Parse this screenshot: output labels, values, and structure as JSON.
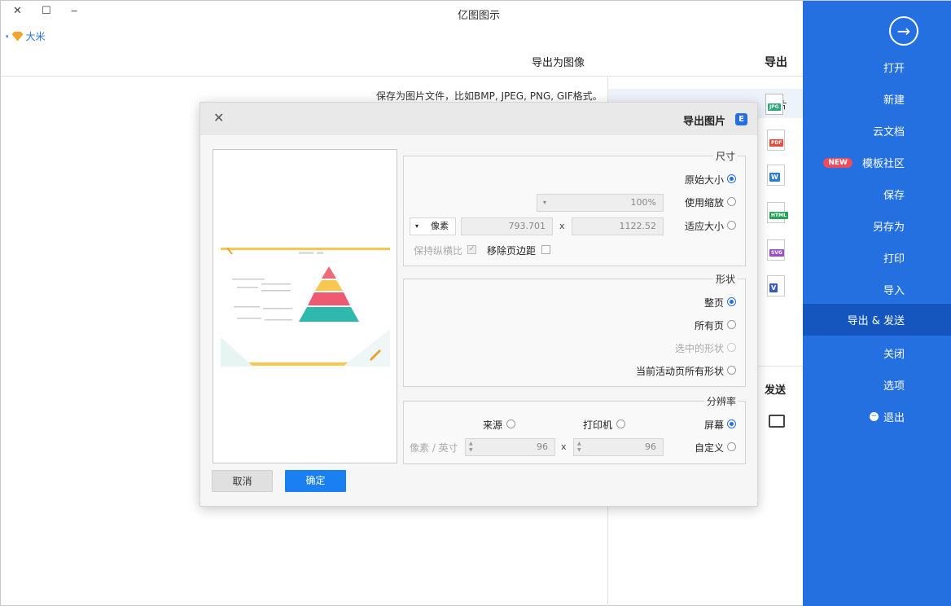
{
  "app": {
    "title": "亿图图示",
    "user": "大米",
    "window_controls": {
      "close": "✕",
      "maximize": "☐",
      "minimize": "‒"
    }
  },
  "sidebar": {
    "items": [
      {
        "label": "打开"
      },
      {
        "label": "新建"
      },
      {
        "label": "云文档"
      },
      {
        "label": "模板社区",
        "badge": "NEW"
      },
      {
        "label": "保存"
      },
      {
        "label": "另存为"
      },
      {
        "label": "打印"
      },
      {
        "label": "导入"
      },
      {
        "label": "导出 & 发送",
        "active": true
      },
      {
        "label": "关闭"
      },
      {
        "label": "选项"
      },
      {
        "label": "退出"
      }
    ]
  },
  "export_page": {
    "export_heading": "导出",
    "section_heading": "导出为图像",
    "description": "保存为图片文件，比如BMP, JPEG, PNG, GIF格式。",
    "formats": [
      "JPG",
      "PDF",
      "W",
      "HTML",
      "SVG",
      "V"
    ],
    "first_format_label": "图片",
    "send_heading": "发送"
  },
  "dialog": {
    "title": "导出图片",
    "logo": "E",
    "size": {
      "label": "尺寸",
      "original": "原始大小",
      "zoom": "使用缩放",
      "zoom_value": "100%",
      "fit": "适应大小",
      "width": "1122.52",
      "height": "793.701",
      "unit": "像素",
      "remove_margin": "移除页边距",
      "keep_ratio": "保持纵横比"
    },
    "shape": {
      "label": "形状",
      "whole_page": "整页",
      "all_pages": "所有页",
      "selected_shapes": "选中的形状",
      "current_page_shapes": "当前活动页所有形状"
    },
    "resolution": {
      "label": "分辨率",
      "screen": "屏幕",
      "printer": "打印机",
      "source": "来源",
      "custom": "自定义",
      "dpi_x": "96",
      "dpi_y": "96",
      "unit": "像素 / 英寸"
    },
    "ok": "确定",
    "cancel": "取消"
  },
  "colors": {
    "sidebar_blue": "#2470e1",
    "ok_blue": "#1a80f1",
    "pyramid_top": "#ee6a7b",
    "pyramid_mid": "#f9c74f",
    "pyramid_low": "#ef5a73",
    "pyramid_base": "#2fb8ac"
  }
}
